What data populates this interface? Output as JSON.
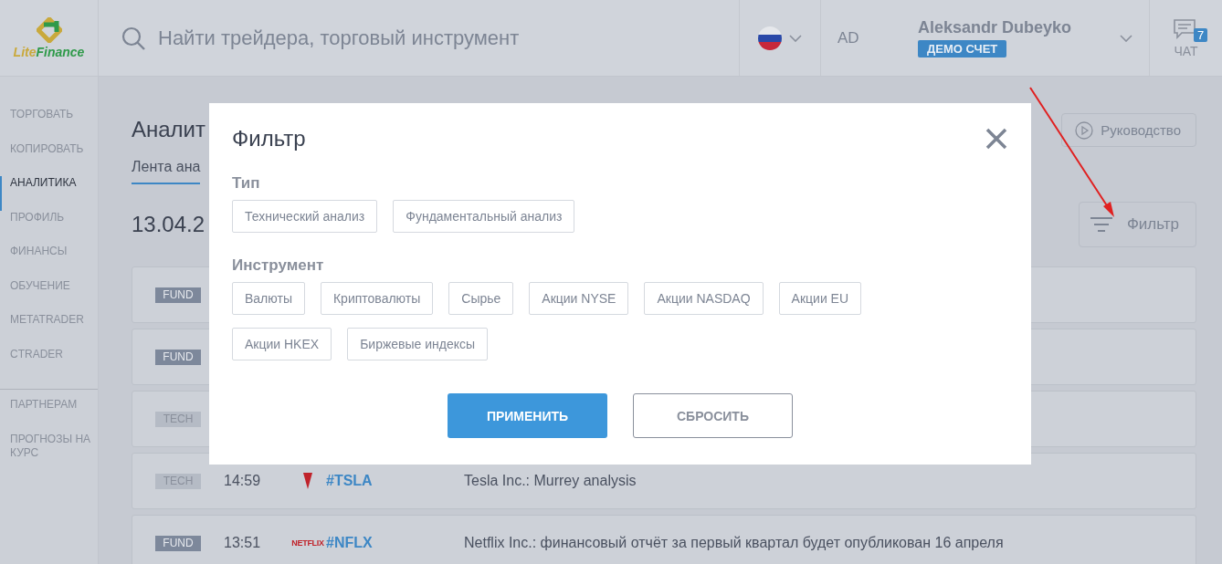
{
  "header": {
    "logo": {
      "text_1": "Lite",
      "text_2": "Finance"
    },
    "search": {
      "placeholder": "Найти трейдера, торговый инструмент"
    },
    "user": {
      "initials": "AD",
      "name": "Aleksandr Dubeyko",
      "account_badge": "ДЕМО СЧЕТ"
    },
    "chat": {
      "badge": "7",
      "label": "ЧАТ"
    }
  },
  "sidebar": {
    "sections": [
      {
        "items": [
          {
            "label": "ТОРГОВАТЬ",
            "selected": false
          },
          {
            "label": "КОПИРОВАТЬ",
            "selected": false
          },
          {
            "label": "АНАЛИТИКА",
            "selected": true
          },
          {
            "label": "ПРОФИЛЬ",
            "selected": false
          },
          {
            "label": "ФИНАНСЫ",
            "selected": false
          },
          {
            "label": "ОБУЧЕНИЕ",
            "selected": false
          },
          {
            "label": "METATRADER",
            "selected": false
          },
          {
            "label": "CTRADER",
            "selected": false
          }
        ]
      },
      {
        "items": [
          {
            "label": "ПАРТНЕРАМ",
            "selected": false
          },
          {
            "label": "ПРОГНОЗЫ НА КУРС",
            "selected": false
          }
        ]
      }
    ]
  },
  "page": {
    "title": "Аналит",
    "tabs": [
      {
        "label": "Лента ана",
        "selected": true
      }
    ],
    "guide_button": "Руководство",
    "date": "13.04.2",
    "filter_button": "Фильтр"
  },
  "feed": [
    {
      "tag": "FUND",
      "kind": "fund"
    },
    {
      "tag": "FUND",
      "kind": "fund"
    },
    {
      "tag": "TECH",
      "kind": "tech"
    },
    {
      "tag": "TECH",
      "kind": "tech",
      "time": "14:59",
      "logo": {
        "kind": "tesla"
      },
      "ticker": "#TSLA",
      "title": "Tesla Inc.: Murrey analysis"
    },
    {
      "tag": "FUND",
      "kind": "fund",
      "time": "13:51",
      "logo": {
        "kind": "netflix",
        "text": "NETFLIX"
      },
      "ticker": "#NFLX",
      "title": "Netflix Inc.: финансовый отчёт за первый квартал будет опубликован 16 апреля"
    }
  ],
  "modal": {
    "title": "Фильтр",
    "sections": [
      {
        "label": "Тип",
        "options": [
          "Технический анализ",
          "Фундаментальный анализ"
        ]
      },
      {
        "label": "Инструмент",
        "options": [
          "Валюты",
          "Криптовалюты",
          "Сырье",
          "Акции NYSE",
          "Акции NASDAQ",
          "Акции EU",
          "Акции HKEX",
          "Биржевые индексы"
        ]
      }
    ],
    "buttons": [
      {
        "label": "ПРИМЕНИТЬ",
        "kind": "primary"
      },
      {
        "label": "СБРОСИТЬ",
        "kind": "secondary"
      }
    ]
  }
}
